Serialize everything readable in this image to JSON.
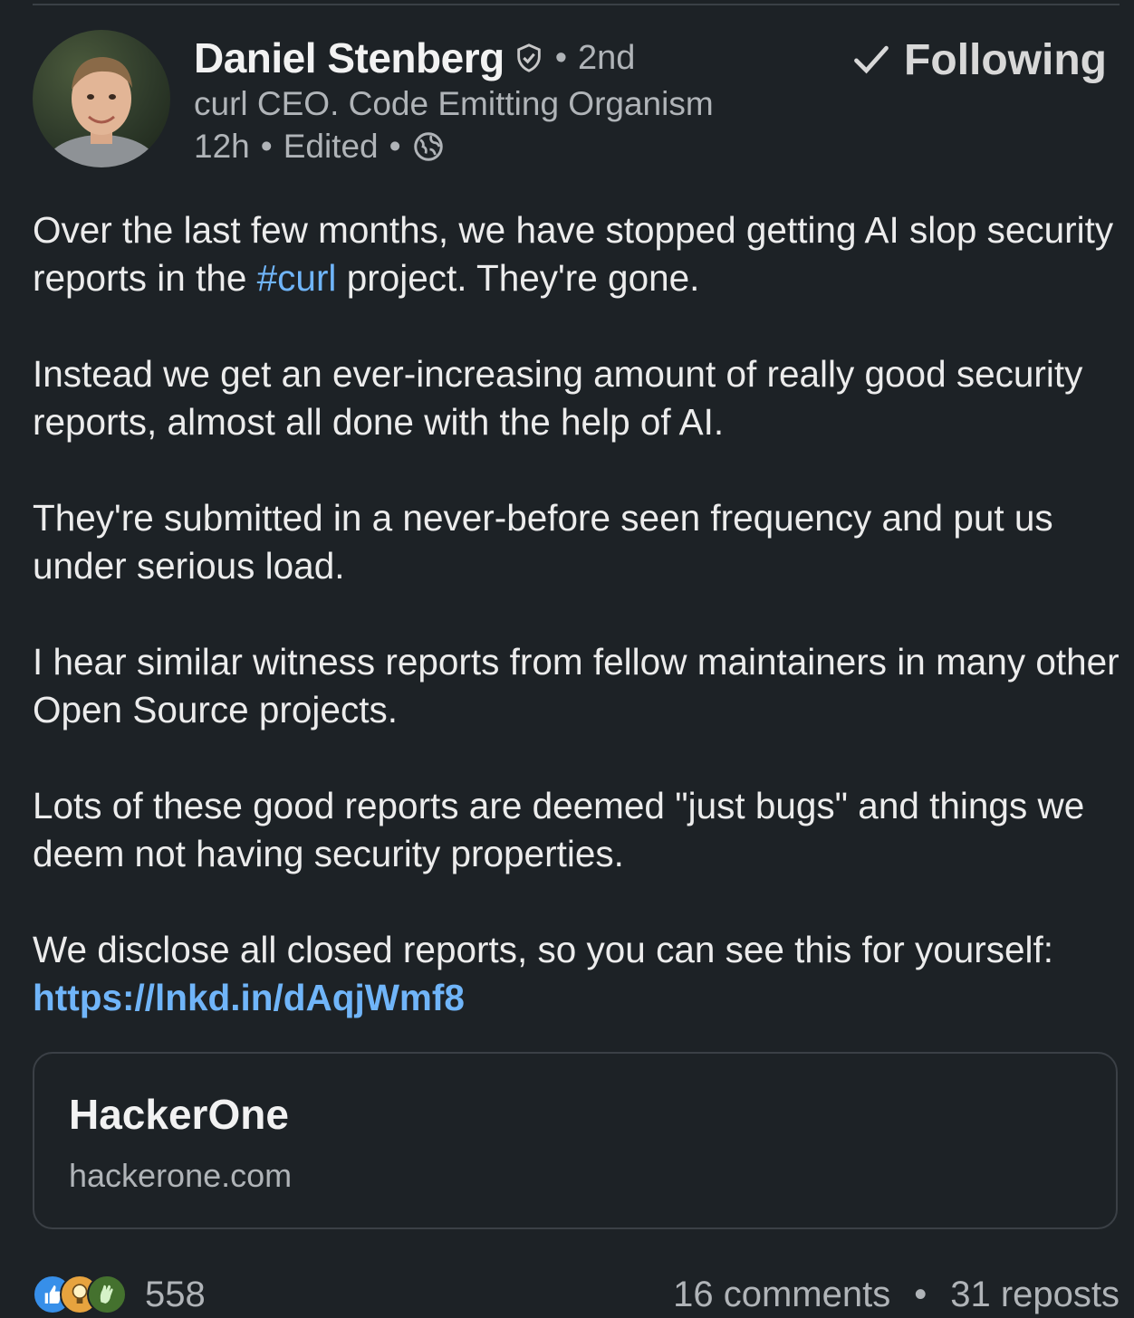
{
  "author": {
    "name": "Daniel Stenberg",
    "degree": "2nd",
    "headline": "curl CEO. Code Emitting Organism",
    "time": "12h",
    "edited": "Edited",
    "separator": "•"
  },
  "follow_button": {
    "label": "Following",
    "icon": "checkmark-icon"
  },
  "post": {
    "p1_before": "Over the last few months, we have stopped getting AI slop security reports in the ",
    "p1_hashtag": "#curl",
    "p1_after": " project. They're gone.",
    "p2": "Instead we get an ever-increasing amount of really good security reports, almost all done with the help of AI.",
    "p3": "They're submitted in a never-before seen frequency and put us under serious load.",
    "p4": "I hear similar witness reports from fellow maintainers in many other Open Source projects.",
    "p5": "Lots of these good reports are deemed \"just bugs\" and things we deem not having security properties.",
    "p6_before": "We disclose all closed reports, so you can see this for yourself: ",
    "p6_link": "https://lnkd.in/dAqjWmf8"
  },
  "link_card": {
    "title": "HackerOne",
    "domain": "hackerone.com"
  },
  "social": {
    "reaction_icons": [
      "like-icon",
      "insightful-icon",
      "celebrate-icon"
    ],
    "reactions_count": "558",
    "comments": "16 comments",
    "separator": "•",
    "reposts": "31 reposts"
  },
  "colors": {
    "background": "#1d2226",
    "link": "#70b5f9",
    "muted": "#b0b4b8"
  }
}
